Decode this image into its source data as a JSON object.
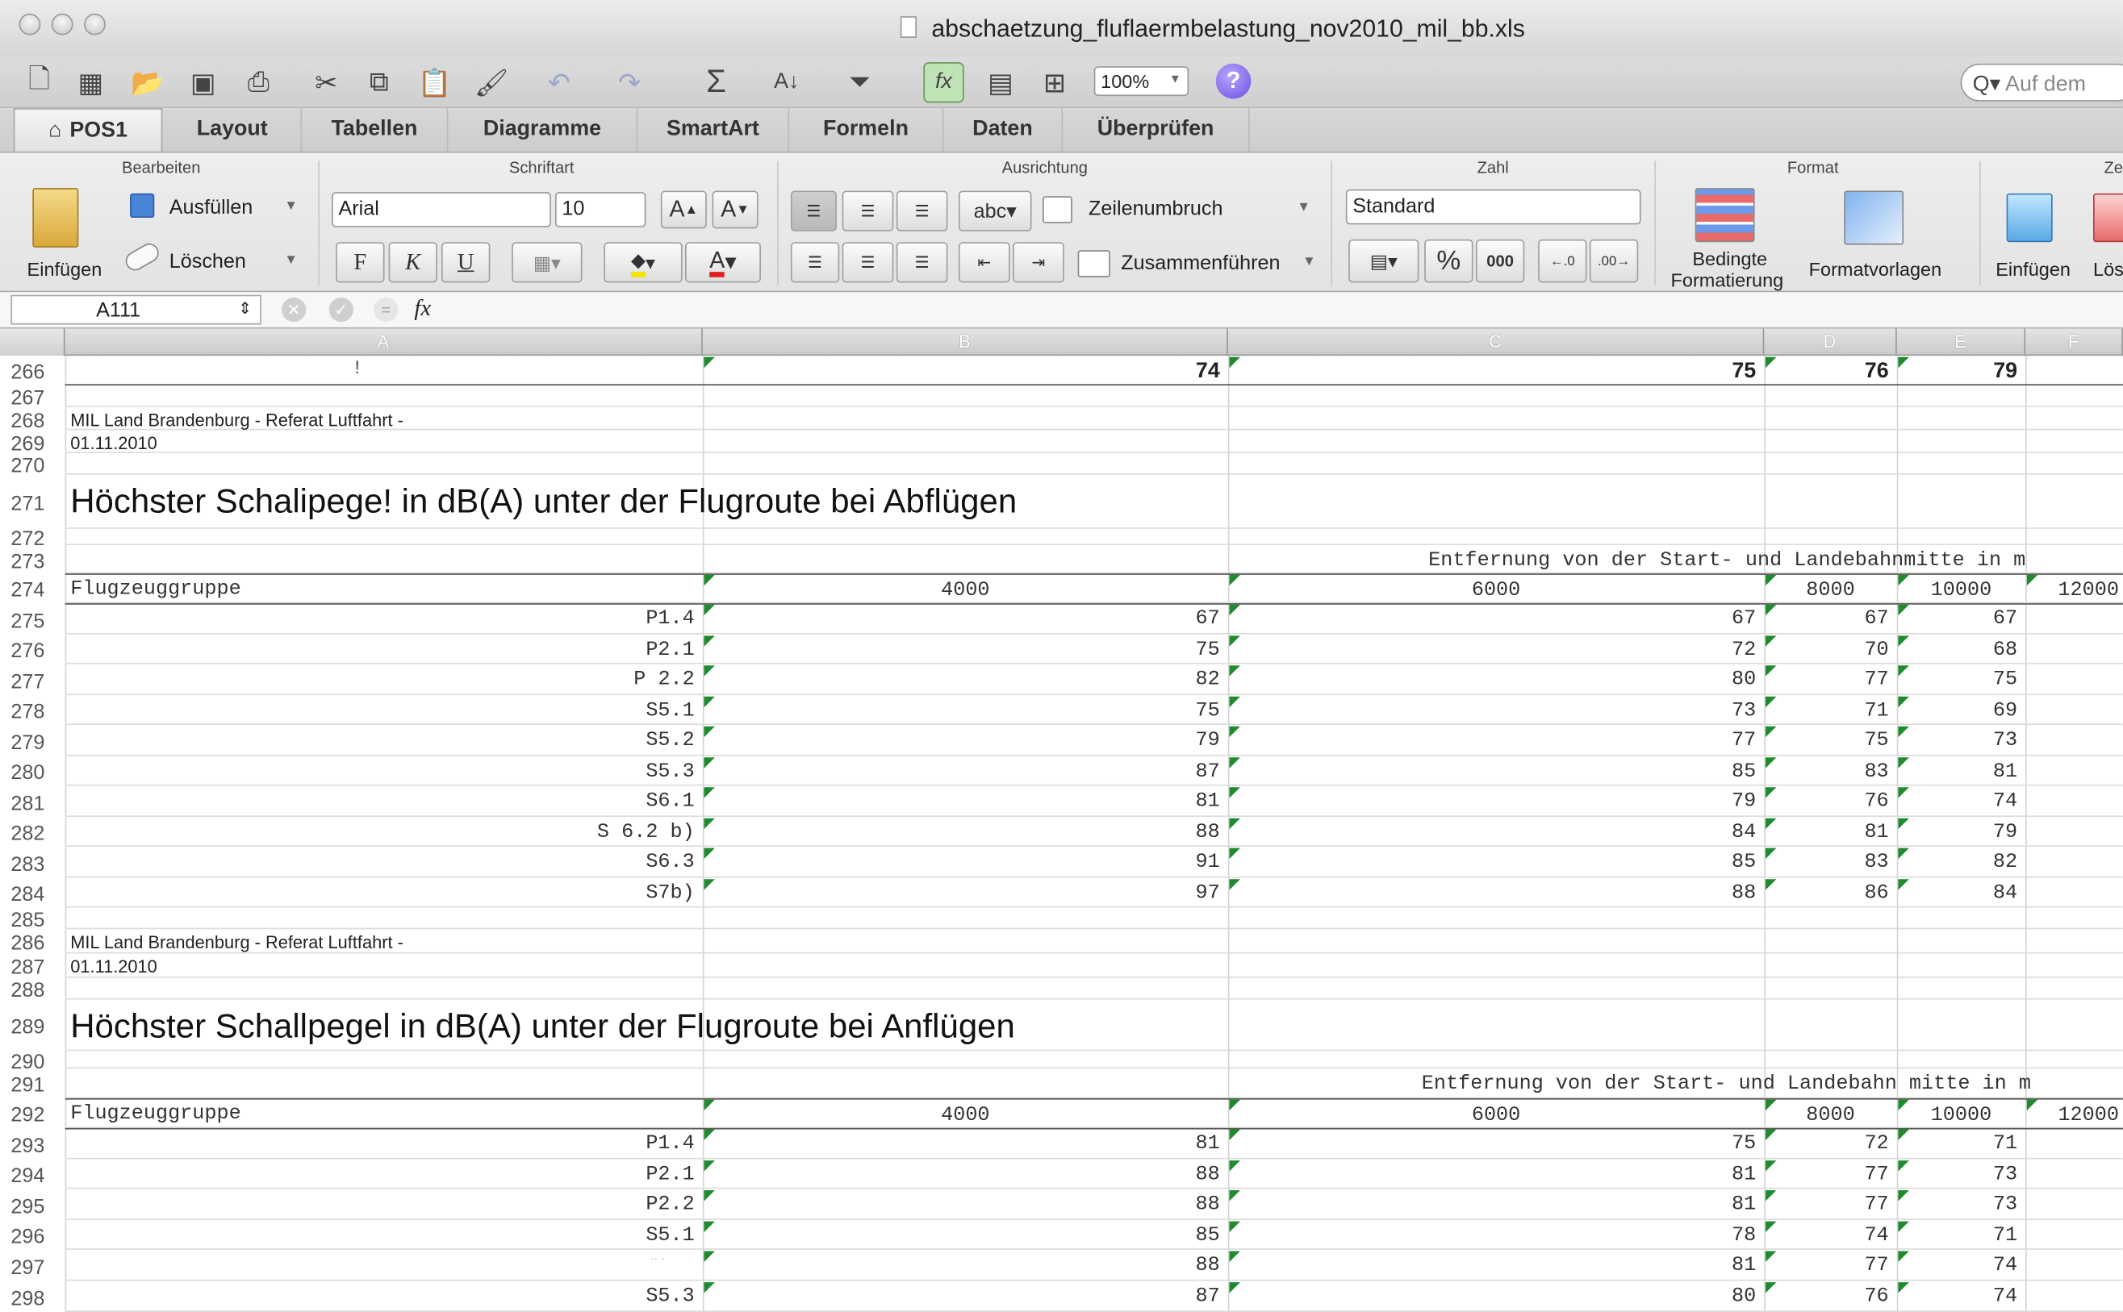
{
  "window": {
    "title": "abschaetzung_fluflaermbelastung_nov2010_mil_bb.xls"
  },
  "toolbar": {
    "zoom": "100%",
    "help": "?",
    "search_placeholder": "Auf dem"
  },
  "tabs": [
    "POS1",
    "Layout",
    "Tabellen",
    "Diagramme",
    "SmartArt",
    "Formeln",
    "Daten",
    "Überprüfen"
  ],
  "ribbon": {
    "groups": [
      "Bearbeiten",
      "Schriftart",
      "Ausrichtung",
      "Zahl",
      "Format",
      "Ze"
    ],
    "einfuegen": "Einfügen",
    "ausfuellen": "Ausfüllen",
    "loeschen": "Löschen",
    "font": "Arial",
    "size": "10",
    "grow": "A",
    "shrink": "A",
    "bold": "F",
    "italic": "K",
    "underline": "U",
    "fontcolor": "A",
    "abc": "abc",
    "wrap": "Zeilenumbruch",
    "merge": "Zusammenführen",
    "numformat": "Standard",
    "percent": "%",
    "thousands": "000",
    "cond_1": "Bedingte",
    "cond_2": "Formatierung",
    "styles": "Formatvorlagen",
    "ins": "Einfügen",
    "del": "Lös"
  },
  "formula": {
    "cell": "A111",
    "fx": "fx"
  },
  "columns": [
    "A",
    "B",
    "C",
    "D",
    "E",
    "F"
  ],
  "sheet": {
    "r266": {
      "b": "74",
      "c": "75",
      "d": "76",
      "e": "79"
    },
    "org": "MIL Land Brandenburg - Referat Luftfahrt -",
    "date": "01.11.2010",
    "title_dep": "Höchster Schalipege! in dB(A) unter der Flugroute bei Abflügen",
    "title_arr": "Höchster Schallpegel in dB(A) unter der Flugroute bei Anflügen",
    "dist_header_dep": "Entfernung von der Start- und Landebahnmitte in m",
    "dist_header_arr": "Entfernung von der Start- und Landebahn mitte in m",
    "group_label": "Flugzeuggruppe",
    "dist": [
      "4000",
      "6000",
      "8000",
      "10000",
      "12000"
    ],
    "dep_rows": [
      {
        "g": "P1.4",
        "v": [
          "67",
          "67",
          "67",
          "67"
        ]
      },
      {
        "g": "P2.1",
        "v": [
          "75",
          "72",
          "70",
          "68"
        ]
      },
      {
        "g": "P 2.2",
        "v": [
          "82",
          "80",
          "77",
          "75"
        ]
      },
      {
        "g": "S5.1",
        "v": [
          "75",
          "73",
          "71",
          "69"
        ]
      },
      {
        "g": "S5.2",
        "v": [
          "79",
          "77",
          "75",
          "73"
        ]
      },
      {
        "g": "S5.3",
        "v": [
          "87",
          "85",
          "83",
          "81"
        ]
      },
      {
        "g": "S6.1",
        "v": [
          "81",
          "79",
          "76",
          "74"
        ]
      },
      {
        "g": "S 6.2 b)",
        "v": [
          "88",
          "84",
          "81",
          "79"
        ]
      },
      {
        "g": "S6.3",
        "v": [
          "91",
          "85",
          "83",
          "82"
        ]
      },
      {
        "g": "S7b)",
        "v": [
          "97",
          "88",
          "86",
          "84"
        ]
      }
    ],
    "arr_rows": [
      {
        "g": "P1.4",
        "v": [
          "81",
          "75",
          "72",
          "71"
        ]
      },
      {
        "g": "P2.1",
        "v": [
          "88",
          "81",
          "77",
          "73"
        ]
      },
      {
        "g": "P2.2",
        "v": [
          "88",
          "81",
          "77",
          "73"
        ]
      },
      {
        "g": "S5.1",
        "v": [
          "85",
          "78",
          "74",
          "71"
        ]
      },
      {
        "g": "",
        "v": [
          "88",
          "81",
          "77",
          "74"
        ]
      },
      {
        "g": "S5.3",
        "v": [
          "87",
          "80",
          "76",
          "74"
        ]
      }
    ]
  },
  "rownums": [
    "266",
    "267",
    "268",
    "269",
    "270",
    "271",
    "272",
    "273",
    "274",
    "275",
    "276",
    "277",
    "278",
    "279",
    "280",
    "281",
    "282",
    "283",
    "284",
    "285",
    "286",
    "287",
    "288",
    "289",
    "290",
    "291",
    "292",
    "293",
    "294",
    "295",
    "296",
    "297",
    "298"
  ]
}
